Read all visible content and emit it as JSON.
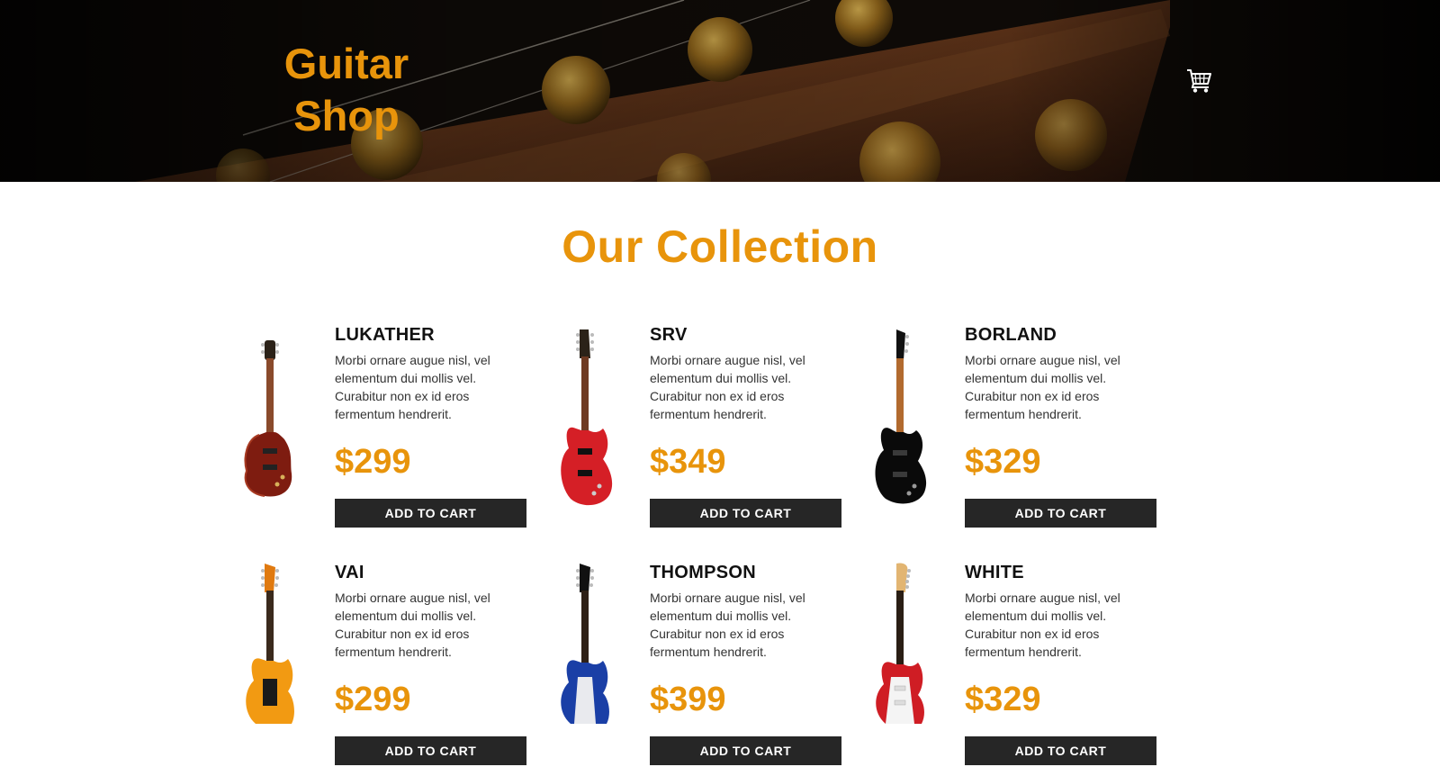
{
  "header": {
    "logo_line1": "Guitar",
    "logo_line2": "Shop",
    "cart_icon": "shopping-cart-icon"
  },
  "colors": {
    "accent": "#e8940b",
    "button_bg": "#262626",
    "heading": "#111111"
  },
  "collection": {
    "title": "Our Collection",
    "products": [
      {
        "name": "LUKATHER",
        "description": "Morbi ornare augue nisl, vel elementum dui mollis vel. Curabitur non ex id eros fermentum hendrerit.",
        "price": "$299",
        "button": "ADD TO CART",
        "image": "les-paul-guitar-red"
      },
      {
        "name": "SRV",
        "description": "Morbi ornare augue nisl, vel elementum dui mollis vel. Curabitur non ex id eros fermentum hendrerit.",
        "price": "$349",
        "button": "ADD TO CART",
        "image": "superstrat-guitar-red"
      },
      {
        "name": "BORLAND",
        "description": "Morbi ornare augue nisl, vel elementum dui mollis vel. Curabitur non ex id eros fermentum hendrerit.",
        "price": "$329",
        "button": "ADD TO CART",
        "image": "superstrat-guitar-black"
      },
      {
        "name": "VAI",
        "description": "Morbi ornare augue nisl, vel elementum dui mollis vel. Curabitur non ex id eros fermentum hendrerit.",
        "price": "$299",
        "button": "ADD TO CART",
        "image": "guitar-orange"
      },
      {
        "name": "THOMPSON",
        "description": "Morbi ornare augue nisl, vel elementum dui mollis vel. Curabitur non ex id eros fermentum hendrerit.",
        "price": "$399",
        "button": "ADD TO CART",
        "image": "guitar-blue"
      },
      {
        "name": "WHITE",
        "description": "Morbi ornare augue nisl, vel elementum dui mollis vel. Curabitur non ex id eros fermentum hendrerit.",
        "price": "$329",
        "button": "ADD TO CART",
        "image": "strat-guitar-red-white"
      }
    ]
  }
}
